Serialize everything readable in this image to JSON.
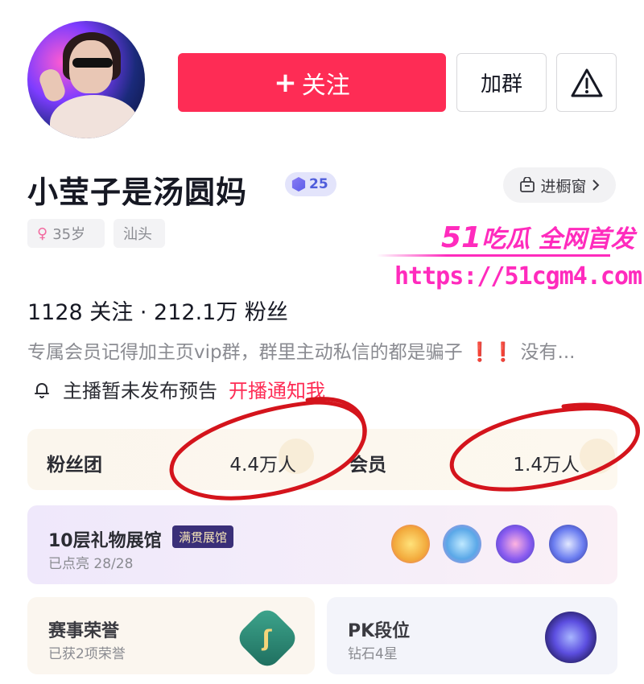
{
  "header": {
    "follow_label": "关注",
    "follow_plus": "+",
    "group_label": "加群"
  },
  "profile": {
    "name": "小莹子是汤圆妈",
    "level": "25",
    "shop_label": "进橱窗",
    "tags": {
      "age": "35岁",
      "city": "汕头"
    },
    "stats": "1128 关注 · 212.1万 粉丝",
    "bio": "专属会员记得加主页vip群，群里主动私信的都是骗子",
    "bio_marks": "❗❗",
    "bio_tail": "没有...",
    "notice": "主播暂未发布预告",
    "notice_link": "开播通知我"
  },
  "watermark": {
    "top_num": "51",
    "top_text": "吃瓜 全网首发",
    "url": "https://51cgm4.com"
  },
  "fanclub": {
    "label": "粉丝团",
    "value": "4.4万人",
    "member_label": "会员",
    "member_value": "1.4万人"
  },
  "gallery": {
    "title": "10层礼物展馆",
    "badge": "满贯展馆",
    "sub": "已点亮 28/28"
  },
  "honor": {
    "title": "赛事荣誉",
    "sub": "已获2项荣誉"
  },
  "pk": {
    "title": "PK段位",
    "sub": "钻石4星"
  },
  "colors": {
    "accent": "#fe2c55",
    "watermark": "#ff2bbd",
    "scribble": "#d4141c"
  }
}
